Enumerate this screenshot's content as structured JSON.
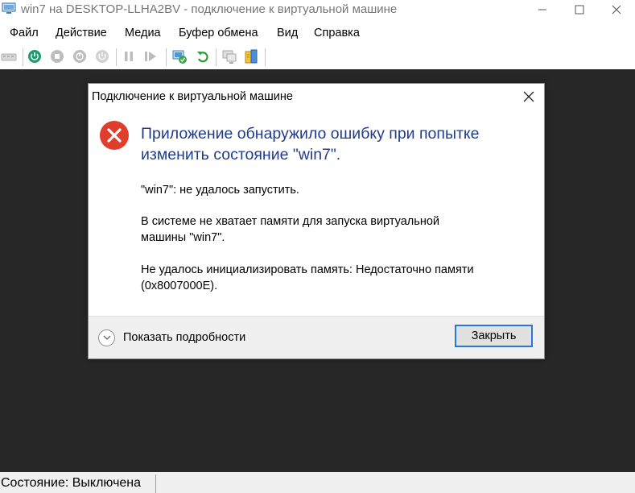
{
  "window": {
    "title": "win7 на DESKTOP-LLHA2BV - подключение к виртуальной машине",
    "icon": "vm-connect-icon",
    "controls": [
      "minimize-icon",
      "maximize-icon",
      "close-icon"
    ]
  },
  "menu": {
    "items": [
      {
        "label": "Файл"
      },
      {
        "label": "Действие"
      },
      {
        "label": "Медиа"
      },
      {
        "label": "Буфер обмена"
      },
      {
        "label": "Вид"
      },
      {
        "label": "Справка"
      }
    ]
  },
  "toolbar": {
    "buttons": [
      {
        "icon": "ctrl-alt-del-icon",
        "enabled": false
      },
      {
        "icon": "start-icon",
        "enabled": true
      },
      {
        "icon": "turn-off-icon",
        "enabled": false
      },
      {
        "icon": "shut-down-icon",
        "enabled": false
      },
      {
        "icon": "save-icon",
        "enabled": false
      },
      {
        "icon": "pause-icon",
        "enabled": false
      },
      {
        "icon": "resume-icon",
        "enabled": false
      },
      {
        "icon": "checkpoint-icon",
        "enabled": true
      },
      {
        "icon": "revert-icon",
        "enabled": true
      },
      {
        "icon": "enhanced-session-icon",
        "enabled": false
      },
      {
        "icon": "share-icon",
        "enabled": true
      }
    ]
  },
  "dialog": {
    "title": "Подключение к виртуальной машине",
    "heading": "Приложение обнаружило ошибку при попытке изменить состояние \"win7\".",
    "messages": [
      "\"win7\": не удалось запустить.",
      "В системе не хватает памяти для запуска виртуальной машины \"win7\".",
      "Не удалось инициализировать память: Недостаточно памяти (0x8007000E)."
    ],
    "details_label": "Показать подробности",
    "close_label": "Закрыть",
    "error_color": "#e03e2d",
    "heading_color": "#1f3c8c",
    "button_focus_color": "#2a77d6"
  },
  "status": {
    "text": "Состояние: Выключена"
  }
}
